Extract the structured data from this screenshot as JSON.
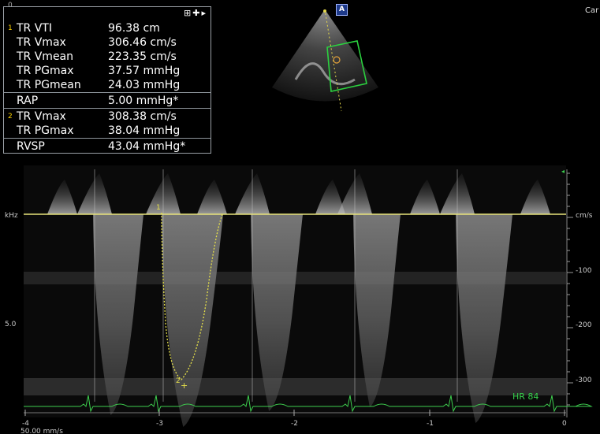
{
  "header": {
    "top_left_zero": "0",
    "top_right_label": "Car",
    "panel_icons": "⊞✚▸",
    "logo_badge": "A"
  },
  "measurements": [
    {
      "idx": "1",
      "label": "TR VTI",
      "value": "96.38 cm"
    },
    {
      "idx": "",
      "label": "TR Vmax",
      "value": "306.46 cm/s"
    },
    {
      "idx": "",
      "label": "TR Vmean",
      "value": "223.35 cm/s"
    },
    {
      "idx": "",
      "label": "TR PGmax",
      "value": "37.57 mmHg"
    },
    {
      "idx": "",
      "label": "TR PGmean",
      "value": "24.03 mmHg"
    },
    {
      "idx": "",
      "label": "RAP",
      "value": "5.00 mmHg*"
    },
    {
      "idx": "2",
      "label": "TR Vmax",
      "value": "308.38 cm/s"
    },
    {
      "idx": "",
      "label": "TR PGmax",
      "value": "38.04 mmHg"
    },
    {
      "idx": "",
      "label": "RVSP",
      "value": "43.04 mmHg*"
    }
  ],
  "doppler": {
    "left_axis": {
      "label_top": "kHz",
      "label_mid": "5.0"
    },
    "right_axis": {
      "unit": "cm/s",
      "ticks": [
        "-100",
        "-200",
        "-300"
      ]
    },
    "time_axis": {
      "ticks": [
        "-4",
        "-3",
        "-2",
        "-1",
        "0"
      ],
      "sweep_speed": "50.00 mm/s"
    },
    "heart_rate": "HR 84",
    "caliper_markers": [
      "1",
      "2"
    ],
    "colors": {
      "baseline": "#e8e37a",
      "trace": "#e6e04a",
      "ecg": "#3ecf4f",
      "hr_text": "#35d14b"
    }
  }
}
